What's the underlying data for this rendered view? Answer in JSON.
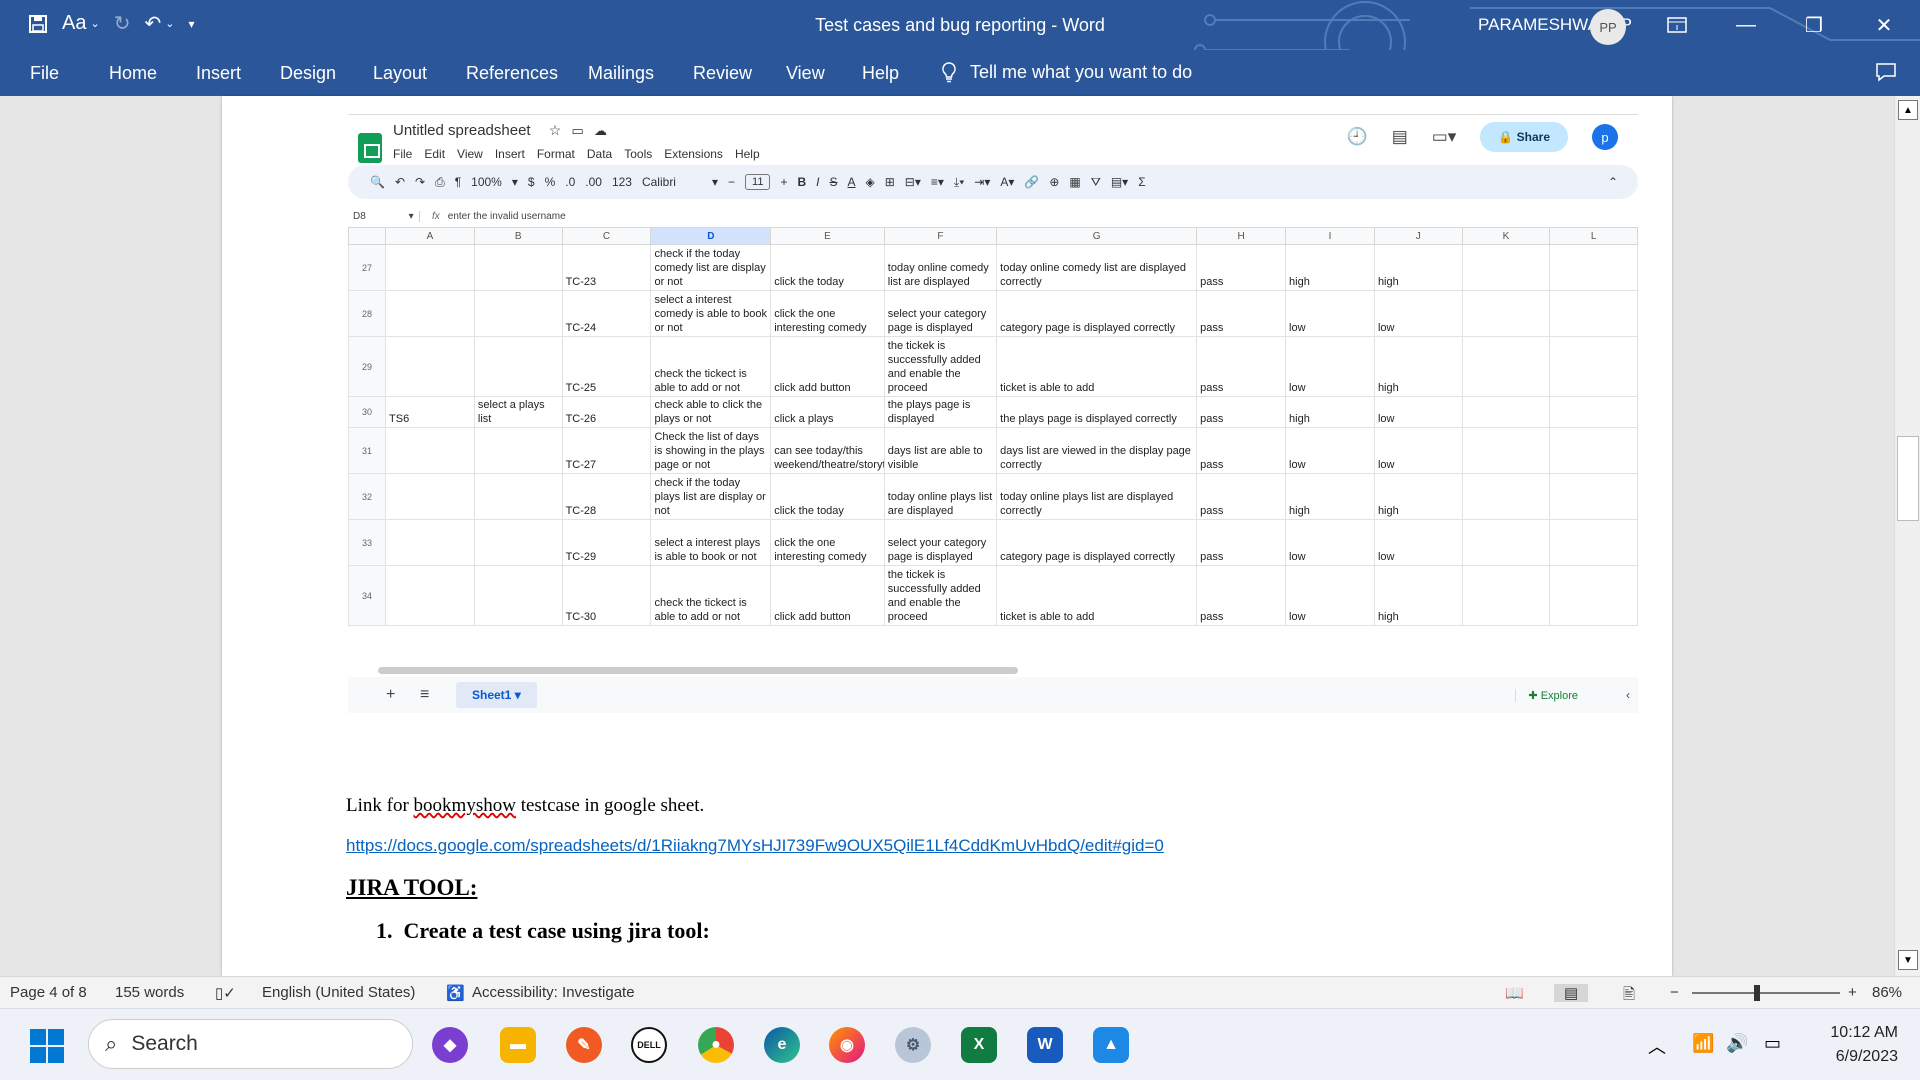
{
  "window": {
    "title": "Test cases and bug reporting  -  Word",
    "user_name": "PARAMESHWARI P",
    "user_initials": "PP"
  },
  "quick_access": {
    "font_label": "Aa"
  },
  "ribbon": {
    "tabs": [
      "File",
      "Home",
      "Insert",
      "Design",
      "Layout",
      "References",
      "Mailings",
      "Review",
      "View",
      "Help"
    ],
    "tell_me": "Tell me what you want to do"
  },
  "sheet": {
    "title": "Untitled spreadsheet",
    "menu": [
      "File",
      "Edit",
      "View",
      "Insert",
      "Format",
      "Data",
      "Tools",
      "Extensions",
      "Help"
    ],
    "share_label": "Share",
    "avatar_initial": "p",
    "toolbar": {
      "zoom": "100%",
      "currency": "$",
      "percent": "%",
      "decrease_decimal": ".0",
      "increase_decimal": ".00",
      "number_format": "123",
      "font": "Calibri",
      "font_size": "11"
    },
    "cell_ref": "D8",
    "formula": "enter the invalid username",
    "columns": [
      "A",
      "B",
      "C",
      "D",
      "E",
      "F",
      "G",
      "H",
      "I",
      "J",
      "K",
      "L"
    ],
    "selected_column": "D",
    "rows": [
      {
        "n": "27",
        "a": "",
        "b": "",
        "c": "TC-23",
        "d": "check if the today comedy list are display  or not",
        "e": "click the today",
        "f": "today online comedy list are displayed",
        "g": "today online comedy list are displayed correctly",
        "h": "pass",
        "i": "high",
        "j": "high"
      },
      {
        "n": "28",
        "a": "",
        "b": "",
        "c": "TC-24",
        "d": "select a interest comedy is able to book or not",
        "e": "click the one interesting comedy",
        "f": " select your category page is displayed",
        "g": "category page is displayed correctly",
        "h": "pass",
        "i": "low",
        "j": "low"
      },
      {
        "n": "29",
        "a": "",
        "b": "",
        "c": "TC-25",
        "d": "check  the tickect is able to add or not",
        "e": "click add button",
        "f": "the tickek is successfully added and enable the proceed",
        "g": "ticket is able to add",
        "h": "pass",
        "i": "low",
        "j": "high"
      },
      {
        "n": "30",
        "a": "TS6",
        "b": "select a plays list",
        "c": "TC-26",
        "d": "check able to click the plays or not",
        "e": "click a plays",
        "f": "the plays page is displayed",
        "g": "the plays page is displayed correctly",
        "h": "pass",
        "i": "high",
        "j": "low"
      },
      {
        "n": "31",
        "a": "",
        "b": "",
        "c": "TC-27",
        "d": "Check the list of days is showing in the plays page or not",
        "e": "can see today/this weekend/theatre/storytelling",
        "f": "days list are able to visible",
        "g": "days list are viewed in the display page correctly",
        "h": "pass",
        "i": "low",
        "j": "low"
      },
      {
        "n": "32",
        "a": "",
        "b": "",
        "c": "TC-28",
        "d": "check if the today plays list are display  or not",
        "e": "click the today",
        "f": "today online plays list are displayed",
        "g": "today online plays list are displayed correctly",
        "h": "pass",
        "i": "high",
        "j": "high"
      },
      {
        "n": "33",
        "a": "",
        "b": "",
        "c": "TC-29",
        "d": "select a interest plays is able to book or not",
        "e": "click the one interesting comedy",
        "f": " select your category page is displayed",
        "g": "category page is displayed correctly",
        "h": "pass",
        "i": "low",
        "j": "low"
      },
      {
        "n": "34",
        "a": "",
        "b": "",
        "c": "TC-30",
        "d": "check  the tickect is able to add or not",
        "e": "click add button",
        "f": "the tickek is successfully added and enable the proceed",
        "g": "ticket is able to add",
        "h": "pass",
        "i": "low",
        "j": "high"
      }
    ],
    "sheet_tab": "Sheet1",
    "explore": "Explore"
  },
  "document": {
    "link_caption_prefix": "Link for ",
    "link_caption_word": "bookmyshow",
    "link_caption_suffix": " testcase in google sheet.",
    "url": "https://docs.google.com/spreadsheets/d/1Riiakng7MYsHJI739Fw9OUX5QilE1Lf4CddKmUvHbdQ/edit#gid=0",
    "heading": "JIRA TOOL:",
    "list_number": "1.",
    "list_item": "Create a test case using jira tool:"
  },
  "status": {
    "page": "Page 4 of 8",
    "words": "155 words",
    "language": "English (United States)",
    "accessibility": "Accessibility: Investigate",
    "zoom": "86%"
  },
  "taskbar": {
    "search": "Search",
    "time": "10:12 AM",
    "date": "6/9/2023"
  },
  "colors": {
    "word_blue": "#2b579a",
    "sheets_green": "#0f9d58",
    "link_blue": "#0563c1"
  }
}
